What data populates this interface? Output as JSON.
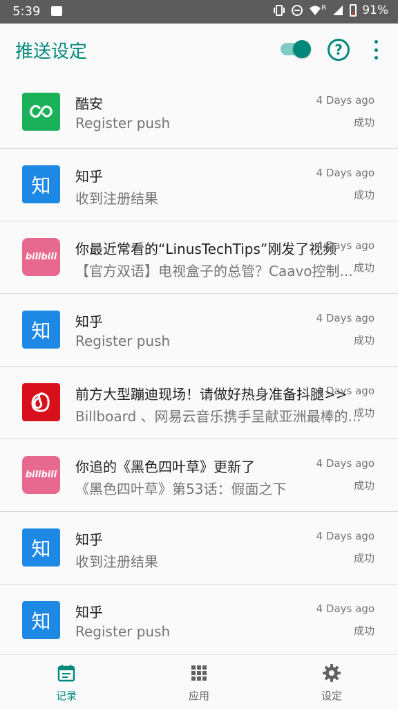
{
  "status_bar": {
    "time": "5:39",
    "battery_percent": "91%",
    "r_indicator": "R"
  },
  "app_bar": {
    "title": "推送设定",
    "push_enabled": true,
    "help_glyph": "?",
    "accent": "#00897b"
  },
  "records": [
    {
      "app": "coolapk",
      "icon": "coolapk-icon",
      "icon_color": "#1bb15b",
      "title": "酷安",
      "subtitle": "Register push",
      "time": "4 Days ago",
      "status": "成功"
    },
    {
      "app": "zhihu",
      "icon": "zhihu-icon",
      "icon_color": "#1e88e5",
      "icon_text": "知",
      "title": "知乎",
      "subtitle": "收到注册结果",
      "time": "4 Days ago",
      "status": "成功"
    },
    {
      "app": "bilibili",
      "icon": "bilibili-icon",
      "icon_color": "#e8698f",
      "icon_text": "bilibili",
      "title": "你最近常看的“LinusTechTips”刚发了视频",
      "subtitle": "【官方双语】电视盒子的总管？Caavo控制...",
      "time": "4 Days ago",
      "status": "成功"
    },
    {
      "app": "zhihu",
      "icon": "zhihu-icon",
      "icon_color": "#1e88e5",
      "icon_text": "知",
      "title": "知乎",
      "subtitle": "Register push",
      "time": "4 Days ago",
      "status": "成功"
    },
    {
      "app": "netease-music",
      "icon": "netease-music-icon",
      "icon_color": "#d7101b",
      "title": "前方大型蹦迪现场！请做好热身准备抖腿>>",
      "subtitle": "Billboard 、网易云音乐携手呈献亚洲最棒的...",
      "time": "4 Days ago",
      "status": "成功"
    },
    {
      "app": "bilibili",
      "icon": "bilibili-icon",
      "icon_color": "#e8698f",
      "icon_text": "bilibili",
      "title": "你追的《黑色四叶草》更新了",
      "subtitle": "《黑色四叶草》第53话：假面之下",
      "time": "4 Days ago",
      "status": "成功"
    },
    {
      "app": "zhihu",
      "icon": "zhihu-icon",
      "icon_color": "#1e88e5",
      "icon_text": "知",
      "title": "知乎",
      "subtitle": "收到注册结果",
      "time": "4 Days ago",
      "status": "成功"
    },
    {
      "app": "zhihu",
      "icon": "zhihu-icon",
      "icon_color": "#1e88e5",
      "icon_text": "知",
      "title": "知乎",
      "subtitle": "Register push",
      "time": "4 Days ago",
      "status": "成功"
    }
  ],
  "bottom_nav": [
    {
      "label": "记录",
      "icon": "calendar-icon",
      "active": true
    },
    {
      "label": "应用",
      "icon": "apps-grid-icon",
      "active": false
    },
    {
      "label": "设定",
      "icon": "gear-icon",
      "active": false
    }
  ]
}
